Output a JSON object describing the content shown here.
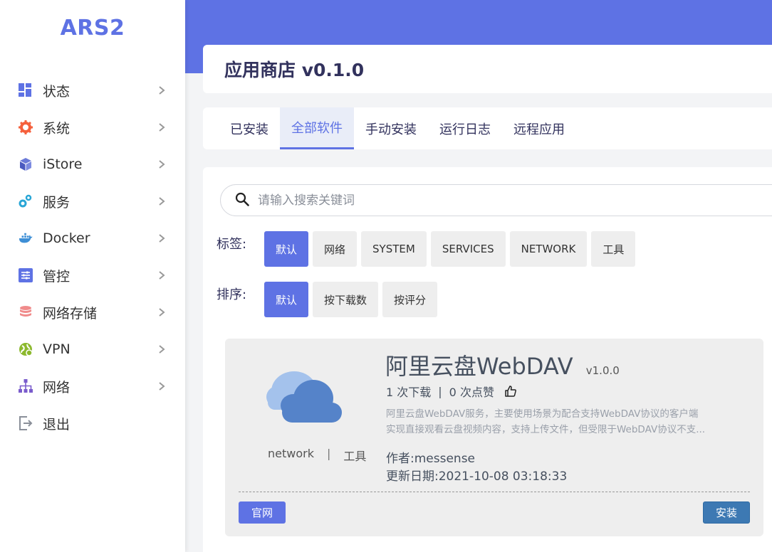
{
  "brand": {
    "logo": "ARS2",
    "accent_color": "#5e72e4"
  },
  "sidebar": {
    "items": [
      {
        "label": "状态",
        "icon": "dashboard-icon",
        "has_submenu": true
      },
      {
        "label": "系统",
        "icon": "gear-icon",
        "has_submenu": true
      },
      {
        "label": "iStore",
        "icon": "cube-icon",
        "has_submenu": true
      },
      {
        "label": "服务",
        "icon": "gears-icon",
        "has_submenu": true
      },
      {
        "label": "Docker",
        "icon": "docker-icon",
        "has_submenu": true
      },
      {
        "label": "管控",
        "icon": "sliders-icon",
        "has_submenu": true
      },
      {
        "label": "网络存储",
        "icon": "database-icon",
        "has_submenu": true
      },
      {
        "label": "VPN",
        "icon": "globe-icon",
        "has_submenu": true
      },
      {
        "label": "网络",
        "icon": "sitemap-icon",
        "has_submenu": true
      },
      {
        "label": "退出",
        "icon": "logout-icon",
        "has_submenu": false
      }
    ]
  },
  "header": {
    "title": "应用商店 v0.1.0"
  },
  "tabs": [
    {
      "label": "已安装",
      "active": false
    },
    {
      "label": "全部软件",
      "active": true
    },
    {
      "label": "手动安装",
      "active": false
    },
    {
      "label": "运行日志",
      "active": false
    },
    {
      "label": "远程应用",
      "active": false
    }
  ],
  "search": {
    "placeholder": "请输入搜索关键词",
    "value": ""
  },
  "filters": {
    "tags": {
      "label": "标签:",
      "options": [
        "默认",
        "网络",
        "SYSTEM",
        "SERVICES",
        "NETWORK",
        "工具"
      ],
      "selected": "默认"
    },
    "sort": {
      "label": "排序:",
      "options": [
        "默认",
        "按下载数",
        "按评分"
      ],
      "selected": "默认"
    }
  },
  "app": {
    "name": "阿里云盘WebDAV",
    "version": "v1.0.0",
    "downloads": "1 次下载",
    "stats_separator": "|",
    "likes": "0 次点赞",
    "description_line1": "阿里云盘WebDAV服务，主要使用场景为配合支持WebDAV协议的客户端",
    "description_line2": "实现直接观看云盘视频内容，支持上传文件，但受限于WebDAV协议不支...",
    "author": "作者:messense",
    "updated": "更新日期:2021-10-08 03:18:33",
    "tags": [
      "network",
      "工具"
    ],
    "tag_separator": "|",
    "website_button": "官网",
    "install_button": "安装",
    "icon": "cloud-icon"
  }
}
